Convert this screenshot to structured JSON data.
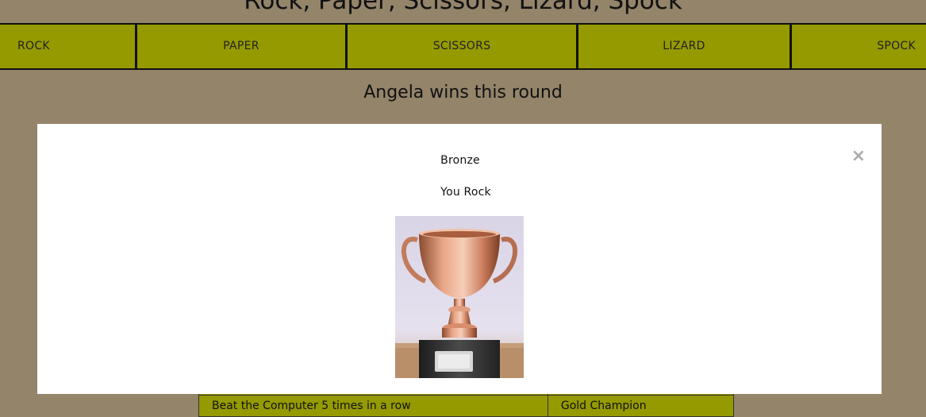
{
  "page": {
    "title": "Rock, Paper, Scissors, Lizard, Spock"
  },
  "choices": [
    {
      "label": "ROCK"
    },
    {
      "label": "PAPER"
    },
    {
      "label": "SCISSORS"
    },
    {
      "label": "LIZARD"
    },
    {
      "label": "SPOCK"
    }
  ],
  "round": {
    "result": "Angela wins this round"
  },
  "modal": {
    "close_symbol": "×",
    "trophy_name": "Bronze",
    "message": "You Rock",
    "image_icon": "bronze-trophy"
  },
  "awards_table": {
    "rows": [
      {
        "achievement": "",
        "award": ""
      },
      {
        "achievement": "Beat the Computer 5 times in a row",
        "award": "Gold Champion"
      }
    ]
  },
  "colors": {
    "background": "#93846a",
    "choice_bar": "#959a00",
    "modal": "#ffffff",
    "close": "#aaaaaa"
  }
}
